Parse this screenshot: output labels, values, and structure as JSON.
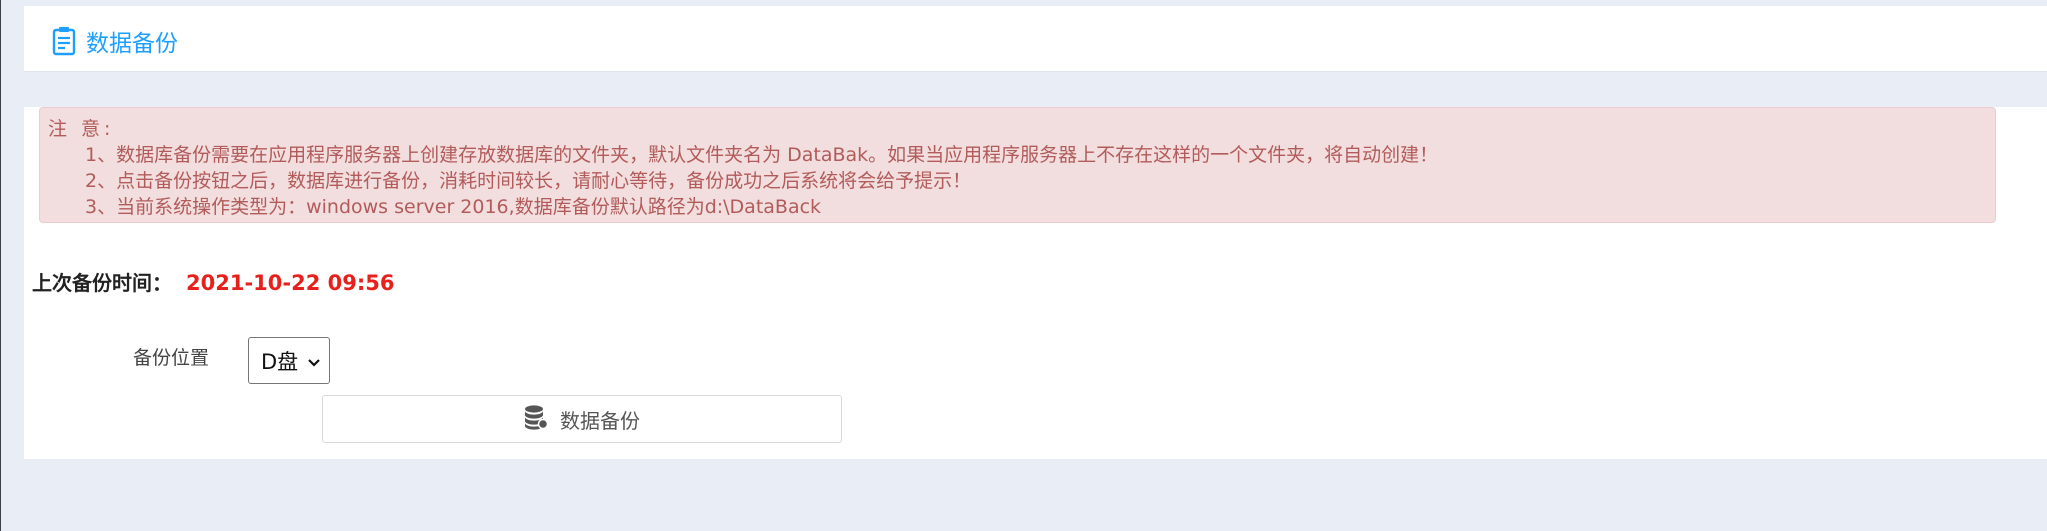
{
  "header": {
    "title": "数据备份",
    "icon": "document-list-icon",
    "accent_color": "#1e9fff"
  },
  "notice": {
    "title": "注 意:",
    "lines": [
      "1、数据库备份需要在应用程序服务器上创建存放数据库的文件夹，默认文件夹名为 DataBak。如果当应用程序服务器上不存在这样的一个文件夹，将自动创建！",
      "2、点击备份按钮之后，数据库进行备份，消耗时间较长，请耐心等待，备份成功之后系统将会给予提示！",
      "3、当前系统操作类型为：windows server 2016,数据库备份默认路径为d:\\DataBack"
    ],
    "background_color": "#f2dede",
    "text_color": "#b25b5b"
  },
  "last_backup": {
    "label": "上次备份时间：",
    "value": "2021-10-22 09:56",
    "value_color": "#e8201b"
  },
  "form": {
    "location_label": "备份位置",
    "location_selected": "D盘",
    "backup_button_label": "数据备份",
    "backup_button_icon": "database-icon"
  }
}
